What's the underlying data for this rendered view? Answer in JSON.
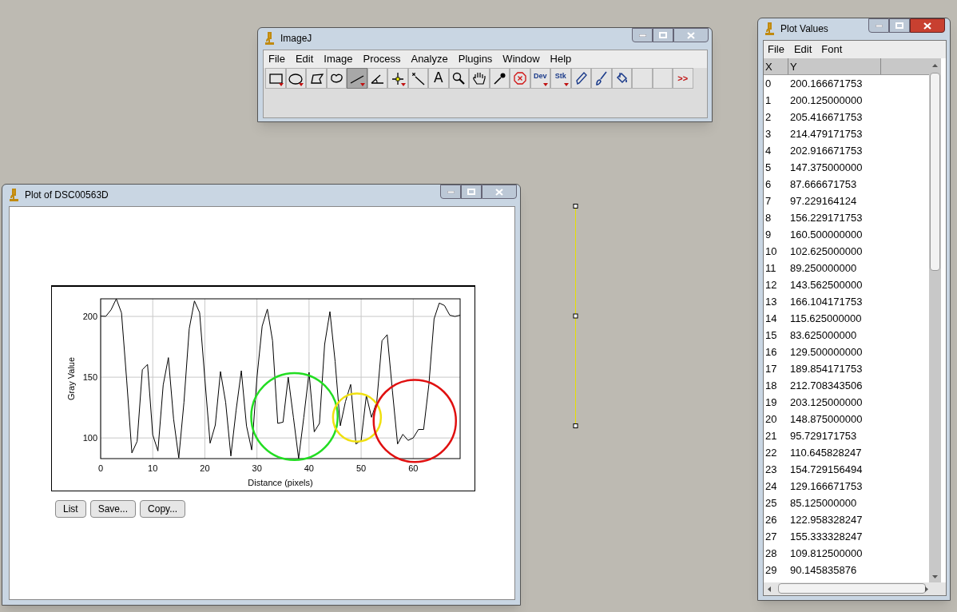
{
  "imagej": {
    "title": "ImageJ",
    "menu": [
      "File",
      "Edit",
      "Image",
      "Process",
      "Analyze",
      "Plugins",
      "Window",
      "Help"
    ],
    "tools": [
      {
        "kind": "rect",
        "selected": false,
        "menu": true
      },
      {
        "kind": "oval",
        "selected": false,
        "menu": true
      },
      {
        "kind": "polygon",
        "selected": false,
        "menu": false
      },
      {
        "kind": "freehand",
        "selected": false,
        "menu": false
      },
      {
        "kind": "line",
        "selected": true,
        "menu": true
      },
      {
        "kind": "angle",
        "selected": false,
        "menu": false
      },
      {
        "kind": "point",
        "selected": false,
        "menu": true
      },
      {
        "kind": "wand",
        "selected": false,
        "menu": false
      },
      {
        "kind": "text",
        "label": "A",
        "selected": false,
        "menu": false
      },
      {
        "kind": "magnifier",
        "selected": false,
        "menu": false
      },
      {
        "kind": "hand",
        "selected": false,
        "menu": false
      },
      {
        "kind": "dropper",
        "selected": false,
        "menu": false
      },
      {
        "kind": "stop",
        "selected": false,
        "menu": false
      },
      {
        "kind": "label",
        "label": "Dev",
        "selected": false,
        "menu": true
      },
      {
        "kind": "label",
        "label": "Stk",
        "selected": false,
        "menu": true
      },
      {
        "kind": "pencil",
        "selected": false,
        "menu": false
      },
      {
        "kind": "brush",
        "selected": false,
        "menu": false
      },
      {
        "kind": "fill",
        "selected": false,
        "menu": false
      },
      {
        "kind": "blank",
        "selected": false,
        "menu": false
      },
      {
        "kind": "blank",
        "selected": false,
        "menu": false
      },
      {
        "kind": "more",
        "label": ">>",
        "selected": false,
        "menu": false
      }
    ]
  },
  "plot_window": {
    "title": "Plot of DSC00563D",
    "chart_data": {
      "type": "line",
      "xlabel": "Distance (pixels)",
      "ylabel": "Gray Value",
      "xlim": [
        0,
        69
      ],
      "ylim": [
        83,
        214.5
      ],
      "xticks": [
        0,
        10,
        20,
        30,
        40,
        50,
        60
      ],
      "yticks": [
        100,
        150,
        200
      ],
      "x": [
        0,
        1,
        2,
        3,
        4,
        5,
        6,
        7,
        8,
        9,
        10,
        11,
        12,
        13,
        14,
        15,
        16,
        17,
        18,
        19,
        20,
        21,
        22,
        23,
        24,
        25,
        26,
        27,
        28,
        29,
        30,
        31,
        32,
        33,
        34,
        35,
        36,
        37,
        38,
        39,
        40,
        41,
        42,
        43,
        44,
        45,
        46,
        47,
        48,
        49,
        50,
        51,
        52,
        53,
        54,
        55,
        56,
        57,
        58,
        59,
        60,
        61,
        62,
        63,
        64,
        65,
        66,
        67,
        68,
        69
      ],
      "grid": true,
      "values": [
        200.2,
        200.1,
        205.4,
        214.5,
        202.9,
        147.4,
        87.7,
        97.2,
        156.2,
        160.5,
        102.6,
        89.3,
        143.6,
        166.1,
        115.6,
        83.6,
        129.5,
        189.9,
        212.7,
        203.1,
        148.9,
        95.7,
        110.6,
        154.7,
        129.2,
        85.1,
        123.0,
        155.3,
        109.8,
        90.1,
        150,
        192,
        206,
        180,
        112,
        113,
        150,
        117,
        83,
        117,
        154,
        105,
        112,
        177,
        204,
        163,
        110,
        130,
        144,
        95,
        98,
        135,
        117,
        130,
        180,
        185,
        139,
        95,
        103,
        98,
        100,
        107,
        107,
        144,
        198,
        211,
        209,
        201,
        200,
        201
      ]
    },
    "circles": [
      {
        "color": "#22dd22"
      },
      {
        "color": "#f0e010"
      },
      {
        "color": "#e01010"
      }
    ],
    "buttons": [
      "List",
      "Save...",
      "Copy..."
    ]
  },
  "values_window": {
    "title": "Plot Values",
    "menu": [
      "File",
      "Edit",
      "Font"
    ],
    "columns": [
      "X",
      "Y"
    ],
    "rows": [
      [
        "0",
        "200.166671753"
      ],
      [
        "1",
        "200.125000000"
      ],
      [
        "2",
        "205.416671753"
      ],
      [
        "3",
        "214.479171753"
      ],
      [
        "4",
        "202.916671753"
      ],
      [
        "5",
        "147.375000000"
      ],
      [
        "6",
        "87.666671753"
      ],
      [
        "7",
        "97.229164124"
      ],
      [
        "8",
        "156.229171753"
      ],
      [
        "9",
        "160.500000000"
      ],
      [
        "10",
        "102.625000000"
      ],
      [
        "11",
        "89.250000000"
      ],
      [
        "12",
        "143.562500000"
      ],
      [
        "13",
        "166.104171753"
      ],
      [
        "14",
        "115.625000000"
      ],
      [
        "15",
        "83.625000000"
      ],
      [
        "16",
        "129.500000000"
      ],
      [
        "17",
        "189.854171753"
      ],
      [
        "18",
        "212.708343506"
      ],
      [
        "19",
        "203.125000000"
      ],
      [
        "20",
        "148.875000000"
      ],
      [
        "21",
        "95.729171753"
      ],
      [
        "22",
        "110.645828247"
      ],
      [
        "23",
        "154.729156494"
      ],
      [
        "24",
        "129.166671753"
      ],
      [
        "25",
        "85.125000000"
      ],
      [
        "26",
        "122.958328247"
      ],
      [
        "27",
        "155.333328247"
      ],
      [
        "28",
        "109.812500000"
      ],
      [
        "29",
        "90.145835876"
      ]
    ]
  }
}
